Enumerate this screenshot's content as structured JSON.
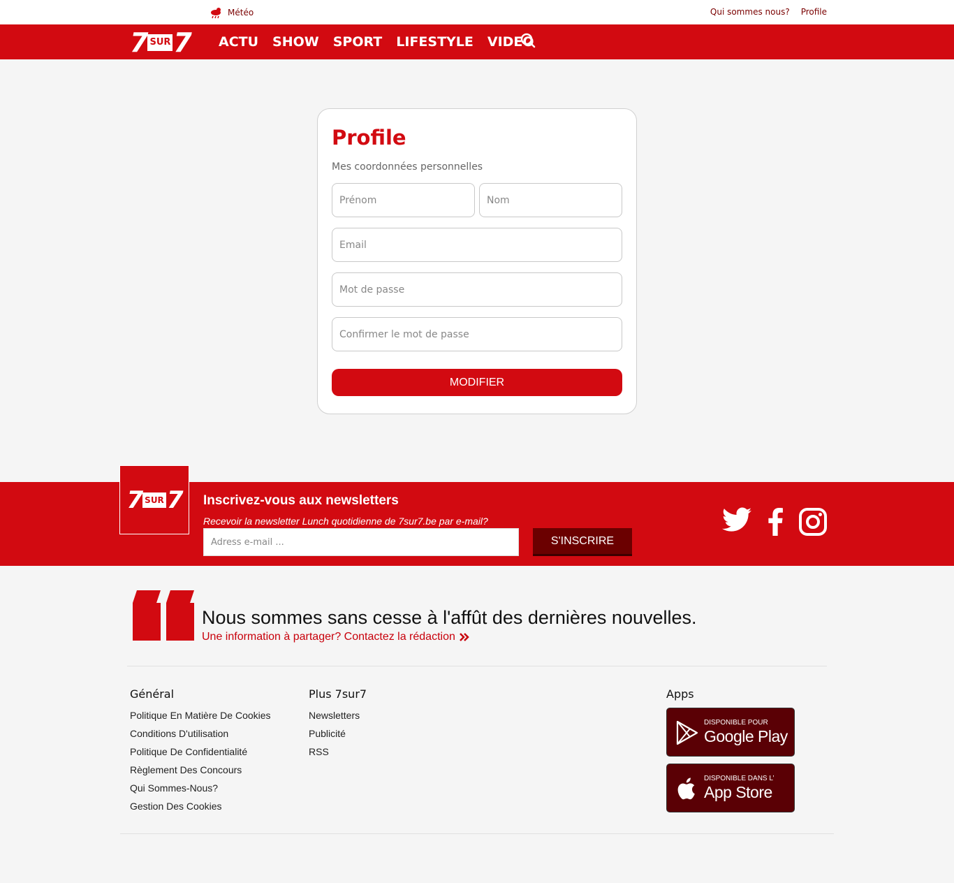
{
  "topbar": {
    "weather_label": "Météo",
    "links": [
      "Qui sommes nous?",
      "Profile"
    ]
  },
  "nav": {
    "logo": {
      "left": "7",
      "mid": "SUR",
      "right": "7"
    },
    "items": [
      "ACTU",
      "SHOW",
      "SPORT",
      "LIFESTYLE",
      "VIDEO"
    ]
  },
  "profile": {
    "title": "Profile",
    "subtitle": "Mes coordonnées personnelles",
    "firstname_placeholder": "Prénom",
    "lastname_placeholder": "Nom",
    "email_placeholder": "Email",
    "password_placeholder": "Mot de passe",
    "confirm_placeholder": "Confirmer le mot de passe",
    "submit_label": "MODIFIER"
  },
  "newsletter": {
    "title": "Inscrivez-vous aux newsletters",
    "subtitle": "Recevoir la newsletter Lunch quotidienne de 7sur7.be par e-mail?",
    "email_placeholder": "Adress e-mail ...",
    "button_label": "S'INSCRIRE",
    "social": [
      "twitter-icon",
      "facebook-icon",
      "instagram-icon"
    ]
  },
  "contact": {
    "title": "Nous sommes sans cesse à l'affût des dernières nouvelles.",
    "link": "Une information à partager? Contactez la rédaction"
  },
  "footer": {
    "general": {
      "title": "Général",
      "links": [
        "Politique En Matière De Cookies",
        "Conditions D'utilisation",
        "Politique De Confidentialité",
        "Règlement Des Concours",
        "Qui Sommes-Nous?",
        "Gestion Des Cookies"
      ]
    },
    "plus": {
      "title": "Plus 7sur7",
      "links": [
        "Newsletters",
        "Publicité",
        "RSS"
      ]
    },
    "apps": {
      "title": "Apps",
      "google": {
        "small": "DISPONIBLE POUR",
        "big": "Google Play"
      },
      "apple": {
        "small": "DISPONIBLE DANS L’",
        "big": "App Store"
      }
    }
  },
  "colors": {
    "brand": "#d20a11",
    "dark": "#5a0005"
  }
}
